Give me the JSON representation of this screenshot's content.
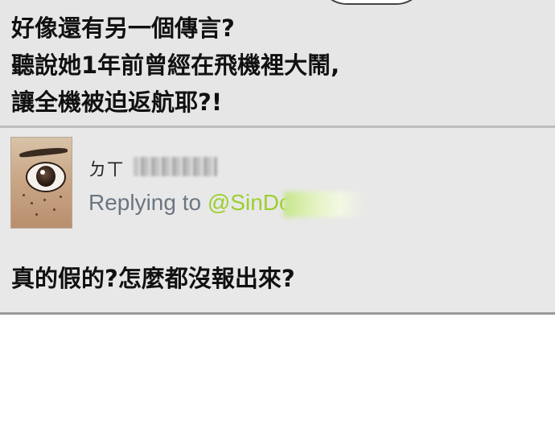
{
  "top_post": {
    "lines": [
      "好像還有另一個傳言?",
      "聽說她1年前曾經在飛機裡大鬧,",
      "讓全機被迫返航耶?!"
    ]
  },
  "reply_post": {
    "username_visible": "ㄉㄒ",
    "replying_prefix": "Replying to",
    "replying_handle": "@SinDot",
    "text": "真的假的?怎麼都沒報出來?"
  },
  "colors": {
    "panel_bg": "#e6e6e6",
    "handle_green": "#9ccf2f",
    "replying_gray": "#6b7680",
    "text_dark": "#111111"
  }
}
